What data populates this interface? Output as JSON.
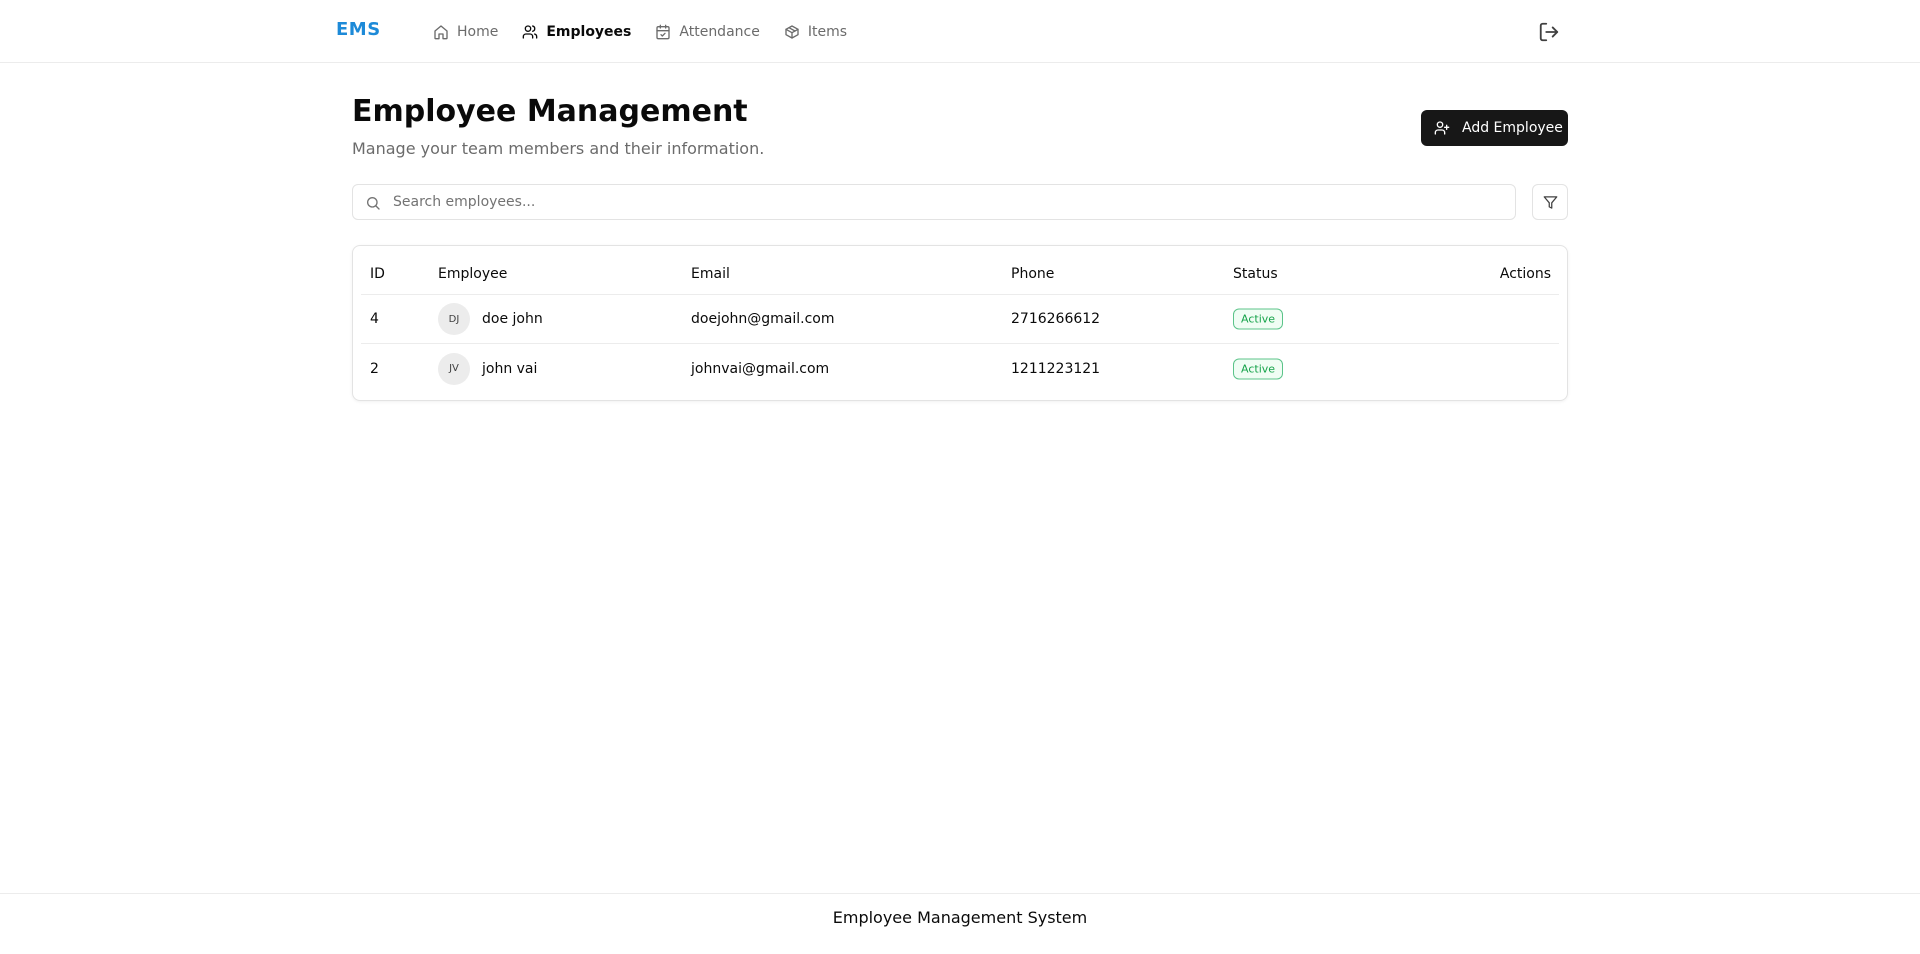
{
  "nav": {
    "brand": "EMS",
    "items": [
      {
        "label": "Home",
        "icon": "home-icon",
        "active": false
      },
      {
        "label": "Employees",
        "icon": "users-icon",
        "active": true
      },
      {
        "label": "Attendance",
        "icon": "calendar-check-icon",
        "active": false
      },
      {
        "label": "Items",
        "icon": "package-icon",
        "active": false
      }
    ],
    "logout_icon": "log-out-icon"
  },
  "header": {
    "title": "Employee Management",
    "subtitle": "Manage your team members and their information.",
    "add_button_label": "Add Employee"
  },
  "search": {
    "placeholder": "Search employees...",
    "value": ""
  },
  "table": {
    "columns": [
      "ID",
      "Employee",
      "Email",
      "Phone",
      "Status",
      "Actions"
    ],
    "rows": [
      {
        "id": "4",
        "initials": "DJ",
        "name": "doe john",
        "email": "doejohn@gmail.com",
        "phone": "2716266612",
        "status": "Active"
      },
      {
        "id": "2",
        "initials": "JV",
        "name": "john vai",
        "email": "johnvai@gmail.com",
        "phone": "1211223121",
        "status": "Active"
      }
    ]
  },
  "colors": {
    "brand": "#1d8ad8",
    "primary_button": "#171717",
    "status_active": "#16a34a"
  },
  "footer": {
    "text": "Employee Management System"
  }
}
